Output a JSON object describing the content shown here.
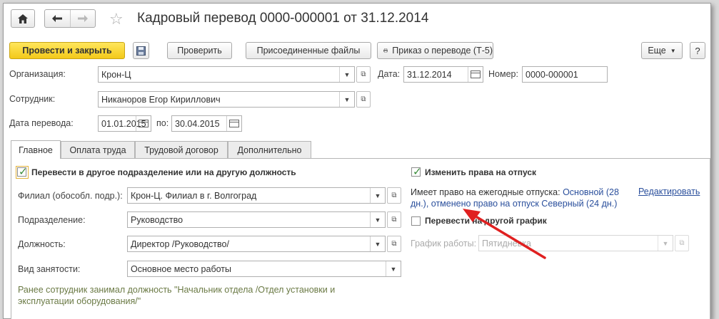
{
  "window": {
    "title": "Кадровый перевод 0000-000001 от 31.12.2014"
  },
  "toolbar": {
    "post_close": "Провести и закрыть",
    "check": "Проверить",
    "attachments": "Присоединенные файлы",
    "print_order": "Приказ о переводе (Т-5)",
    "more": "Еще"
  },
  "header": {
    "org_label": "Организация:",
    "org_value": "Крон-Ц",
    "date_label": "Дата:",
    "date_value": "31.12.2014",
    "number_label": "Номер:",
    "number_value": "0000-000001",
    "employee_label": "Сотрудник:",
    "employee_value": "Никаноров Егор Кириллович",
    "transfer_date_label": "Дата перевода:",
    "transfer_date_value": "01.01.2015",
    "to_label": "по:",
    "to_value": "30.04.2015"
  },
  "tabs": [
    {
      "label": "Главное",
      "active": true
    },
    {
      "label": "Оплата труда",
      "active": false
    },
    {
      "label": "Трудовой договор",
      "active": false
    },
    {
      "label": "Дополнительно",
      "active": false
    }
  ],
  "main": {
    "transfer_checkbox_label": "Перевести в другое подразделение или на другую должность",
    "transfer_checked": true,
    "branch_label": "Филиал (обособл. подр.):",
    "branch_value": "Крон-Ц. Филиал в г. Волгоград",
    "department_label": "Подразделение:",
    "department_value": "Руководство",
    "position_label": "Должность:",
    "position_value": "Директор /Руководство/",
    "employment_label": "Вид занятости:",
    "employment_value": "Основное место работы",
    "note_line1": "Ранее сотрудник занимал должность \"Начальник отдела /Отдел установки и",
    "note_line2": "эксплуатации оборудования/\""
  },
  "right": {
    "vacation_checkbox_label": "Изменить права на отпуск",
    "vacation_checked": true,
    "rights_prefix": "Имеет право на ежегодные отпуска:",
    "rights_link1": "Основной (28",
    "rights_link2": "дн.), отменено право на отпуск Северный (24 дн.)",
    "edit_link": "Редактировать",
    "schedule_checkbox_label": "Перевести на другой график",
    "schedule_checked": false,
    "schedule_label": "График работы:",
    "schedule_value": "Пятидневка"
  },
  "colors": {
    "primary_button": "#f3c919",
    "link": "#2a4f9c",
    "check": "#3a8c3a",
    "arrow": "#e02020"
  }
}
